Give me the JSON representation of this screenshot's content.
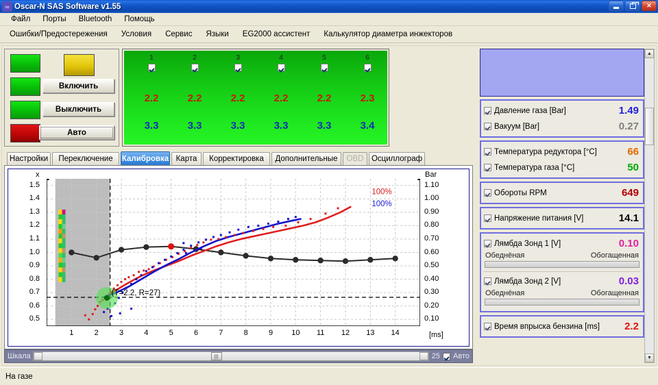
{
  "window": {
    "title": "Oscar-N SAS Software v1.55",
    "icon": "app-icon",
    "minimize": "–",
    "restore": "❐",
    "close": "✕"
  },
  "menu": {
    "items": [
      "Файл",
      "Порты",
      "Bluetooth",
      "Помощь"
    ]
  },
  "toolbar_menu": {
    "items": [
      "Ошибки/Предостережения",
      "Условия",
      "Сервис",
      "Языки",
      "EG2000 ассистент",
      "Калькулятор диаметра инжекторов"
    ]
  },
  "controls": {
    "lamps": [
      "green",
      "green",
      "green",
      "red"
    ],
    "indicator": "yellow",
    "buttons": [
      {
        "label": "Включить",
        "focused": false
      },
      {
        "label": "Выключить",
        "focused": false
      },
      {
        "label": "Авто",
        "focused": true
      }
    ]
  },
  "cylinders": {
    "columns": [
      {
        "num": "1",
        "checked": true,
        "petrol": "2.2",
        "gas": "3.3"
      },
      {
        "num": "2",
        "checked": true,
        "petrol": "2.2",
        "gas": "3.3"
      },
      {
        "num": "3",
        "checked": true,
        "petrol": "2.2",
        "gas": "3.3"
      },
      {
        "num": "4",
        "checked": true,
        "petrol": "2.2",
        "gas": "3.3"
      },
      {
        "num": "5",
        "checked": true,
        "petrol": "2.2",
        "gas": "3.3"
      },
      {
        "num": "6",
        "checked": true,
        "petrol": "2.3",
        "gas": "3.4"
      }
    ],
    "petrol_color": "#c41a00",
    "gas_color": "#0d2fb5"
  },
  "tabs": {
    "items": [
      {
        "label": "Настройки",
        "state": "normal"
      },
      {
        "label": "Переключение",
        "state": "normal"
      },
      {
        "label": "Калибровка",
        "state": "selected"
      },
      {
        "label": "Карта",
        "state": "normal"
      },
      {
        "label": "Корректировка",
        "state": "normal"
      },
      {
        "label": "Дополнительные",
        "state": "normal"
      },
      {
        "label": "OBD",
        "state": "disabled"
      },
      {
        "label": "Осциллограф",
        "state": "normal"
      }
    ]
  },
  "chart_data": {
    "type": "scatter",
    "title": "",
    "xlabel": "[ms]",
    "ylabel_left": "x",
    "ylabel_right": "Bar",
    "xlim": [
      0,
      15
    ],
    "xticks": [
      1,
      2,
      3,
      4,
      5,
      6,
      7,
      8,
      9,
      10,
      11,
      12,
      13,
      14
    ],
    "left_axis": {
      "label": "x",
      "ticks": [
        "1.5",
        "1.4",
        "1.3",
        "1.2",
        "1.1",
        "1.0",
        "0.9",
        "0.8",
        "0.7",
        "0.6",
        "0.5"
      ],
      "min": 0.45,
      "max": 1.55
    },
    "right_axis": {
      "label": "Bar",
      "ticks": [
        "1.10",
        "1.00",
        "0.90",
        "0.80",
        "0.70",
        "0.60",
        "0.50",
        "0.40",
        "0.30",
        "0.20",
        "0.10"
      ],
      "min": 0.05,
      "max": 1.15
    },
    "annotations": [
      {
        "text": "(T=2.2, R=27)",
        "x": 2.55,
        "y": 0.665
      },
      {
        "text": "100%",
        "x": 13.0,
        "y": 1.42,
        "color": "#d42020"
      },
      {
        "text": "100%",
        "x": 13.0,
        "y": 1.33,
        "color": "#2020d4"
      }
    ],
    "reference_lines": {
      "horizontal_dashed_y": 0.665,
      "vertical_dashed_x": 2.55,
      "gray_region_x": [
        0.35,
        2.55
      ]
    },
    "grid": true,
    "series": [
      {
        "name": "Коррекция (черная линия)",
        "type": "line",
        "color": "#2b2b2b",
        "marker": "circle",
        "x": [
          1.0,
          2.0,
          3.0,
          4.0,
          5.0,
          6.0,
          7.0,
          8.0,
          9.0,
          10.0,
          11.0,
          12.0,
          13.0,
          14.0
        ],
        "y": [
          1.0,
          0.96,
          1.02,
          1.04,
          1.045,
          1.025,
          1.0,
          0.975,
          0.955,
          0.945,
          0.94,
          0.935,
          0.945,
          0.955
        ]
      },
      {
        "name": "Бензин (красная кривая)",
        "type": "line",
        "color": "#e02020",
        "x": [
          2.3,
          2.8,
          3.3,
          3.8,
          4.3,
          4.8,
          5.3,
          5.8,
          6.3,
          6.8,
          7.3,
          7.8,
          8.3,
          8.8,
          9.3,
          9.8,
          10.3,
          10.8,
          11.3,
          11.8,
          12.2
        ],
        "y": [
          0.665,
          0.72,
          0.775,
          0.825,
          0.865,
          0.9,
          0.935,
          0.975,
          1.01,
          1.045,
          1.075,
          1.1,
          1.12,
          1.14,
          1.16,
          1.18,
          1.2,
          1.225,
          1.26,
          1.3,
          1.34
        ]
      },
      {
        "name": "Газ (синяя кривая)",
        "type": "line",
        "color": "#1414c8",
        "x": [
          2.3,
          2.8,
          3.3,
          3.8,
          4.3,
          4.8,
          5.3,
          5.8,
          6.3,
          6.8,
          7.3,
          7.8,
          8.3,
          8.8,
          9.3,
          9.8,
          10.2
        ],
        "y": [
          0.665,
          0.7,
          0.745,
          0.8,
          0.855,
          0.905,
          0.95,
          1.0,
          1.045,
          1.085,
          1.115,
          1.14,
          1.165,
          1.19,
          1.215,
          1.235,
          1.25
        ]
      },
      {
        "name": "Точки бензин",
        "type": "scatter",
        "color": "#e02020",
        "x": [
          1.55,
          1.7,
          1.85,
          1.95,
          2.05,
          2.15,
          2.25,
          2.35,
          2.45,
          2.55,
          2.6,
          2.7,
          2.85,
          3.0,
          3.15,
          3.3,
          3.5,
          3.7,
          3.9,
          4.1,
          4.3,
          4.55,
          4.8,
          5.05,
          5.3,
          5.55,
          5.8,
          6.05,
          6.3,
          6.6,
          6.9,
          7.2,
          7.55,
          7.9,
          8.3,
          8.7,
          9.1,
          9.6,
          10.1,
          10.6,
          11.2,
          11.7
        ],
        "y": [
          0.53,
          0.5,
          0.54,
          0.575,
          0.6,
          0.63,
          0.645,
          0.655,
          0.67,
          0.695,
          0.705,
          0.73,
          0.755,
          0.78,
          0.8,
          0.815,
          0.83,
          0.855,
          0.865,
          0.875,
          0.895,
          0.92,
          0.945,
          0.965,
          0.99,
          1.01,
          1.035,
          1.055,
          1.075,
          1.095,
          1.1,
          1.115,
          1.13,
          1.145,
          1.16,
          1.175,
          1.19,
          1.2,
          1.225,
          1.25,
          1.29,
          1.33
        ]
      },
      {
        "name": "Точки газ",
        "type": "scatter",
        "color": "#1414c8",
        "x": [
          2.3,
          2.45,
          2.6,
          2.75,
          2.9,
          3.05,
          3.2,
          3.4,
          3.6,
          3.8,
          4.0,
          4.25,
          4.5,
          4.75,
          5.0,
          5.25,
          5.5,
          5.8,
          6.1,
          6.4,
          6.7,
          7.0,
          7.35,
          7.7,
          8.1,
          8.5,
          8.9,
          9.3,
          9.7,
          10.0,
          2.95,
          3.4,
          5.5,
          5.6,
          6.2
        ],
        "y": [
          0.555,
          0.58,
          0.525,
          0.62,
          0.66,
          0.7,
          0.735,
          0.765,
          0.8,
          0.83,
          0.86,
          0.89,
          0.92,
          0.945,
          0.97,
          0.995,
          1.02,
          1.05,
          1.075,
          1.095,
          1.115,
          1.13,
          1.15,
          1.17,
          1.19,
          1.2,
          1.215,
          1.23,
          1.25,
          1.265,
          0.545,
          0.58,
          1.07,
          0.995,
          1.03
        ]
      },
      {
        "name": "Активная точка красная",
        "type": "point",
        "color": "#e01010",
        "x": 5.0,
        "y": 1.045
      },
      {
        "name": "Курсор (зеленый маркер)",
        "type": "marker",
        "color": "#54e054",
        "x": 2.42,
        "y": 0.66
      }
    ],
    "level_bar": {
      "description": "vertical dual color strip",
      "x": 0.62,
      "y_range": [
        0.78,
        1.32
      ],
      "left_colors": [
        "#ffd800",
        "#22cc22",
        "#ffd800",
        "#22cc22",
        "#ff9900",
        "#22cc22",
        "#ffd800",
        "#22cc22",
        "#ffd800",
        "#44dd44",
        "#ffaa00",
        "#22cc22",
        "#ffd800",
        "#22cc22",
        "#ffd800"
      ],
      "right_colors": [
        "#cc1188",
        "#2fbf6f",
        "#2fbf6f",
        "#6fcc8f",
        "#2fbf6f",
        "#b49a6a",
        "#2fbf6f",
        "#2fbf6f",
        "#b49a6a",
        "#2fbf6f",
        "#6fcc8f",
        "#2fbf6f",
        "#b49a6a",
        "#2fbf6f",
        "#2fbf6f"
      ]
    }
  },
  "scale_slider": {
    "label": "Шкала",
    "value": "25",
    "auto_label": "Авто",
    "auto_checked": true
  },
  "sidebar": {
    "groups": [
      {
        "id": "pressure",
        "rows": [
          {
            "label": "Давление газа  [Bar]",
            "value": "1.49",
            "color": "#2020e0",
            "checked": true
          },
          {
            "label": "Вакуум  [Bar]",
            "value": "0.27",
            "color": "#808080",
            "checked": true
          }
        ]
      },
      {
        "id": "temperature",
        "rows": [
          {
            "label": "Температура редуктора  [°C]",
            "value": "66",
            "color": "#e06a00",
            "checked": true
          },
          {
            "label": "Температура газа  [°C]",
            "value": "50",
            "color": "#00a800",
            "checked": true
          }
        ]
      },
      {
        "id": "rpm",
        "rows": [
          {
            "label": "Обороты RPM",
            "value": "649",
            "color": "#b00000",
            "checked": true
          }
        ]
      },
      {
        "id": "voltage",
        "rows": [
          {
            "label": "Напряжение питания [V]",
            "value": "14.1",
            "color": "#000000",
            "checked": true
          }
        ]
      },
      {
        "id": "lambda",
        "rows": [
          {
            "label": "Лямбда Зонд 1 [V]",
            "value": "0.10",
            "color": "#e020a0",
            "checked": true,
            "left_label": "Обеднёная",
            "right_label": "Обогащенная",
            "bar": true
          },
          {
            "label": "Лямбда Зонд 2 [V]",
            "value": "0.03",
            "color": "#8020e0",
            "checked": true,
            "left_label": "Обеднёная",
            "right_label": "Обогащенная",
            "bar": true
          }
        ]
      },
      {
        "id": "injection",
        "rows": [
          {
            "label": "Время впрыска бензина [ms]",
            "value": "2.2",
            "color": "#e01010",
            "checked": true
          }
        ]
      }
    ]
  },
  "statusbar": {
    "text": "На газе"
  }
}
